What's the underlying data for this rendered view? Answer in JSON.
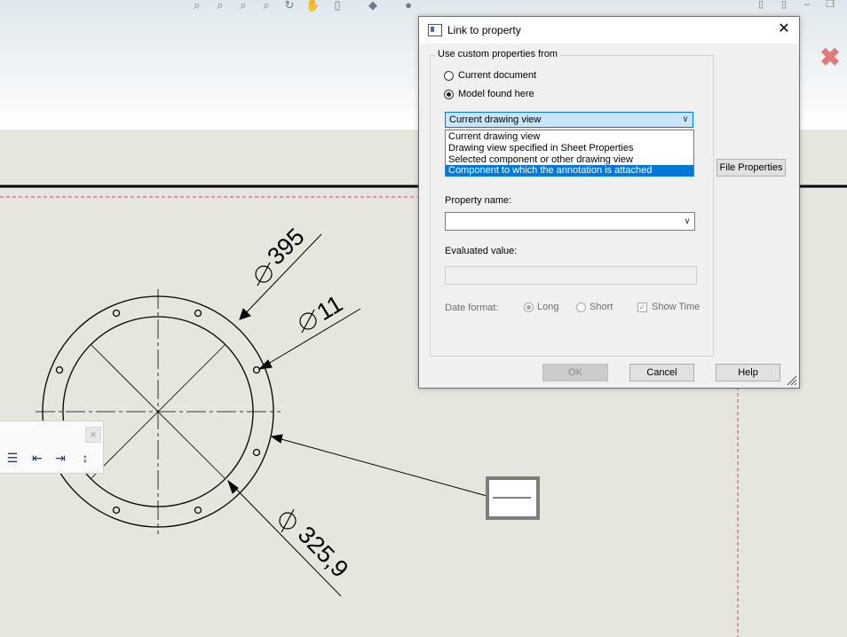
{
  "dialog": {
    "title": "Link to property",
    "group_label": "Use custom properties from",
    "radio_current_document": "Current document",
    "radio_model_found_here": "Model found here",
    "source_selected": "Current drawing view",
    "source_options": [
      "Current drawing view",
      "Drawing view specified in Sheet Properties",
      "Selected component or other drawing view",
      "Component to which the annotation is attached"
    ],
    "file_properties_label": "File Properties",
    "property_name_label": "Property name:",
    "property_name_value": "",
    "evaluated_value_label": "Evaluated value:",
    "evaluated_value": "",
    "date_format_label": "Date format:",
    "date_long": "Long",
    "date_short": "Short",
    "show_time": "Show Time",
    "ok_label": "OK",
    "cancel_label": "Cancel",
    "help_label": "Help"
  },
  "drawing": {
    "dim_395": "395",
    "dim_11": "11",
    "dim_325": "325,9"
  },
  "colors": {
    "sheet_bg": "#e6e6dc",
    "selection_blue": "#0078d7",
    "sheet_border_pink": "#d4379f",
    "close_red": "#e27a7a"
  }
}
